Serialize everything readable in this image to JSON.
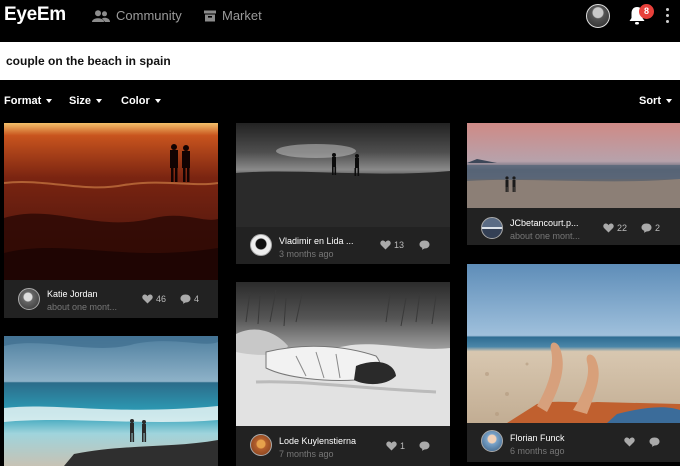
{
  "app": {
    "logo": "EyeEm"
  },
  "nav": {
    "community": "Community",
    "market": "Market",
    "notifications_count": "8"
  },
  "search": {
    "value": "couple on the beach in spain"
  },
  "filters": {
    "format": "Format",
    "size": "Size",
    "color": "Color",
    "sort": "Sort"
  },
  "cards": [
    {
      "user": "Katie Jordan",
      "time": "about one mont...",
      "likes": "46",
      "comments": "4"
    },
    {
      "user": "Vladimir en Lida ...",
      "time": "3 months ago",
      "likes": "13",
      "comments": ""
    },
    {
      "user": "JCbetancourt.p...",
      "time": "about one mont...",
      "likes": "22",
      "comments": "2"
    },
    {
      "user": "Lode Kuylenstierna",
      "time": "7 months ago",
      "likes": "1",
      "comments": ""
    },
    {
      "user": "Florian Funck",
      "time": "6 months ago",
      "likes": "",
      "comments": ""
    }
  ],
  "icons": {
    "community": "community-icon",
    "market": "market-icon",
    "notifications": "bell-icon",
    "menu": "more-vertical-icon",
    "like": "heart-icon",
    "comment": "comment-icon"
  }
}
